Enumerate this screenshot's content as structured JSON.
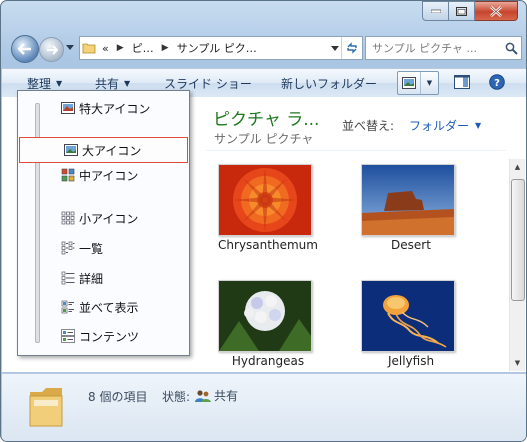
{
  "address_bar": {
    "crumbs": [
      "«",
      "ピ…",
      "サンプル ピク…"
    ]
  },
  "search": {
    "placeholder": "サンプル ピクチャ ..."
  },
  "toolbar": {
    "organize": "整理",
    "share": "共有",
    "slideshow": "スライド ショー",
    "new_folder": "新しいフォルダー"
  },
  "folder": {
    "title": "ピクチャ ラ...",
    "subtitle": "サンプル ピクチャ",
    "arrange_label": "並べ替え:",
    "arrange_value": "フォルダー"
  },
  "files": [
    {
      "name": "Chrysanthemum"
    },
    {
      "name": "Desert"
    },
    {
      "name": "Hydrangeas"
    },
    {
      "name": "Jellyfish"
    }
  ],
  "view_menu": {
    "items": [
      {
        "label": "特大アイコン",
        "icon": "extra-large-icons-icon"
      },
      {
        "label": "大アイコン",
        "icon": "large-icons-icon",
        "selected": true
      },
      {
        "label": "中アイコン",
        "icon": "medium-icons-icon"
      },
      {
        "label": "小アイコン",
        "icon": "small-icons-icon"
      },
      {
        "label": "一覧",
        "icon": "list-view-icon"
      },
      {
        "label": "詳細",
        "icon": "details-view-icon"
      },
      {
        "label": "並べて表示",
        "icon": "tiles-view-icon"
      },
      {
        "label": "コンテンツ",
        "icon": "content-view-icon"
      }
    ]
  },
  "status": {
    "item_count": "8 個の項目",
    "state_label": "状態:",
    "state_value": "共有"
  },
  "colors": {
    "folder_title": "#1e7a1e",
    "link_blue": "#1c5bb7",
    "selection_border": "#e04a3b"
  }
}
